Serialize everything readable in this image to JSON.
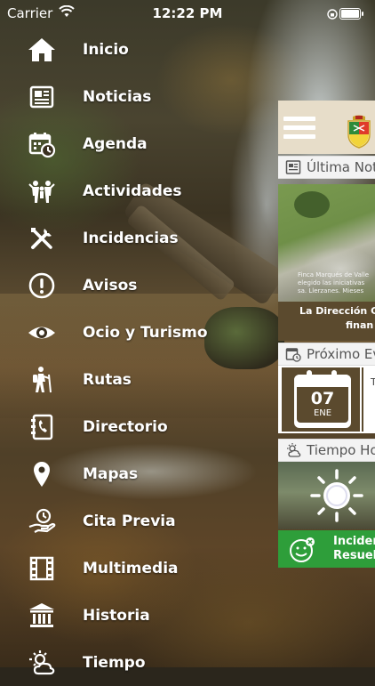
{
  "status_bar": {
    "carrier": "Carrier",
    "time": "12:22 PM"
  },
  "menu": {
    "items": [
      {
        "label": "Inicio",
        "icon": "home-icon"
      },
      {
        "label": "Noticias",
        "icon": "newspaper-icon"
      },
      {
        "label": "Agenda",
        "icon": "calendar-clock-icon"
      },
      {
        "label": "Actividades",
        "icon": "people-icon"
      },
      {
        "label": "Incidencias",
        "icon": "tools-icon"
      },
      {
        "label": "Avisos",
        "icon": "alert-icon"
      },
      {
        "label": "Ocio y Turismo",
        "icon": "eye-icon"
      },
      {
        "label": "Rutas",
        "icon": "hiker-icon"
      },
      {
        "label": "Directorio",
        "icon": "phonebook-icon"
      },
      {
        "label": "Mapas",
        "icon": "map-pin-icon"
      },
      {
        "label": "Cita Previa",
        "icon": "hand-clock-icon"
      },
      {
        "label": "Multimedia",
        "icon": "film-icon"
      },
      {
        "label": "Historia",
        "icon": "museum-icon"
      },
      {
        "label": "Tiempo",
        "icon": "weather-icon"
      }
    ]
  },
  "panel": {
    "latest_news_title": "Última Noti",
    "news_headline_line1": "La Dirección Gen",
    "news_headline_line2": "finan",
    "news_overlay_line1": "Finca Marqués de Valle",
    "news_overlay_line2": "elegido las iniciativas",
    "news_overlay_line3": "sa. Llerzanes. Mieses",
    "next_event_title": "Próximo Ev",
    "event_day": "07",
    "event_month": "ENE",
    "event_text": "T",
    "weather_title": "Tiempo Ho",
    "incidents_line1": "Inciden",
    "incidents_line2": "Resuel"
  },
  "colors": {
    "accent_brown": "#5b4a2e",
    "incidents_green": "#2e9e3a",
    "header_beige": "#e7ddc9"
  }
}
